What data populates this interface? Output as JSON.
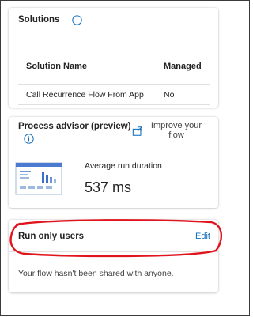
{
  "solutions": {
    "title": "Solutions",
    "columns": [
      "Solution Name",
      "Managed"
    ],
    "rows": [
      {
        "name": "Call Recurrence Flow From App",
        "managed": "No"
      }
    ]
  },
  "process_advisor": {
    "title": "Process advisor (preview)",
    "improve_button": "Improve your flow",
    "avg_label": "Average run duration",
    "avg_value": "537 ms"
  },
  "run_only_users": {
    "title": "Run only users",
    "edit_label": "Edit",
    "message": "Your flow hasn't been shared with anyone."
  },
  "colors": {
    "accent": "#0f6cbd",
    "highlight": "#e0141c"
  }
}
